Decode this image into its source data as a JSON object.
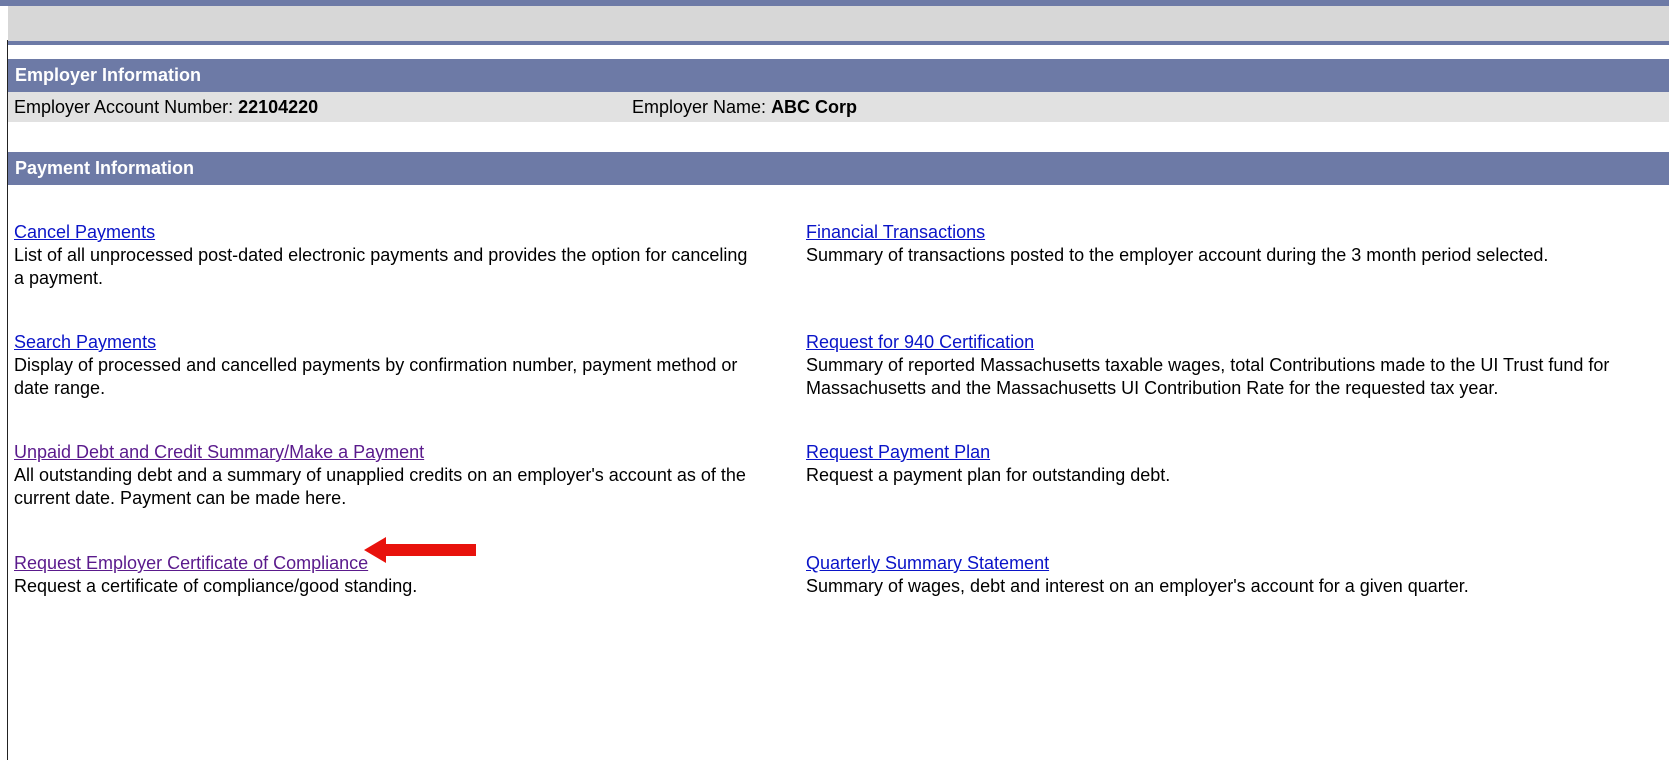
{
  "employer_section": {
    "title": "Employer Information",
    "account_label": "Employer Account Number:",
    "account_number": "22104220",
    "name_label": "Employer Name:",
    "name_value": "ABC Corp"
  },
  "payment_section": {
    "title": "Payment Information",
    "items": [
      {
        "link": "Cancel Payments",
        "desc": "List of all unprocessed post-dated electronic payments and provides the option for canceling a payment."
      },
      {
        "link": "Financial Transactions",
        "desc": "Summary of transactions posted to the employer account during the 3 month period selected."
      },
      {
        "link": "Search Payments",
        "desc": "Display of processed and cancelled payments by confirmation number, payment method or date range."
      },
      {
        "link": "Request for 940 Certification",
        "desc": "Summary of reported Massachusetts taxable wages, total Contributions made to the UI Trust fund for Massachusetts and the Massachusetts UI Contribution Rate for the requested tax year."
      },
      {
        "link": "Unpaid Debt and Credit Summary/Make a Payment",
        "desc": "All outstanding debt and a summary of unapplied credits on an employer's account as of the current date. Payment can be made here."
      },
      {
        "link": "Request Payment Plan",
        "desc": "Request a payment plan for outstanding debt."
      },
      {
        "link": "Request Employer Certificate of Compliance",
        "desc": "Request a certificate of compliance/good standing."
      },
      {
        "link": "Quarterly Summary Statement",
        "desc": "Summary of wages, debt and interest on an employer's account for a given quarter."
      }
    ]
  },
  "annotation": {
    "arrow_icon": "left-arrow-icon",
    "arrow_color": "#e8120c"
  },
  "colors": {
    "header_bg": "#6d7aa6",
    "row_bg": "#e1e1e1",
    "link": "#0a14c8",
    "link_visited": "#5a1a8c"
  }
}
